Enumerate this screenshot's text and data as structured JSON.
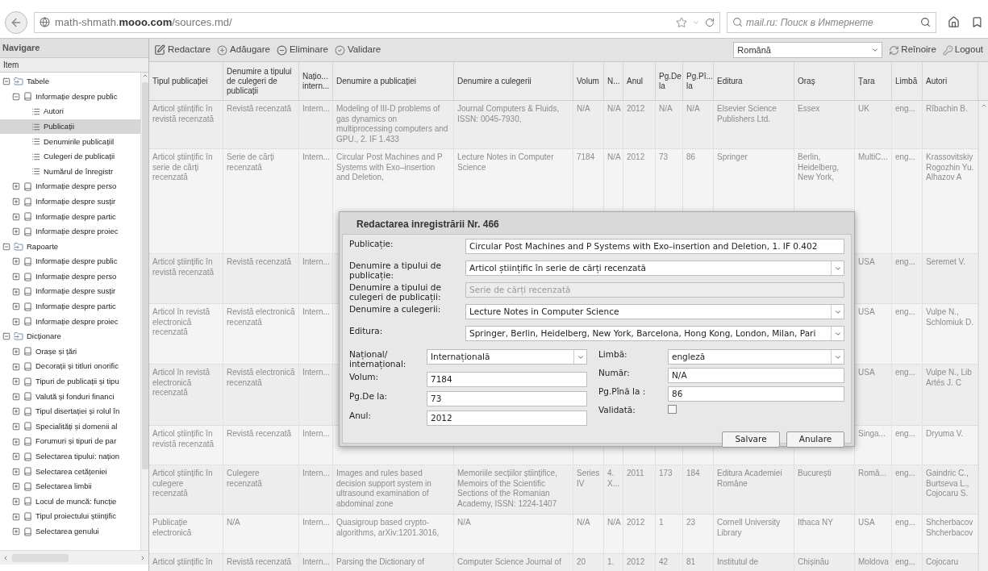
{
  "browser": {
    "url": "math-shmath.**mooo.com**/sources.md/",
    "search_placeholder": "mail.ru: Поиск в Интернете"
  },
  "sidebar": {
    "title": "Navigare",
    "column": "Item",
    "tree": [
      {
        "label": "Tabele",
        "kind": "folder",
        "expanded": true,
        "selected": false,
        "children": [
          {
            "label": "Informație despre public",
            "kind": "book",
            "expanded": true,
            "selected": false,
            "children": [
              {
                "label": "Autori",
                "kind": "table",
                "selected": false
              },
              {
                "label": "Publicații",
                "kind": "table",
                "selected": true
              },
              {
                "label": "Denumirile publicațiil",
                "kind": "table",
                "selected": false
              },
              {
                "label": "Culegeri de publicații",
                "kind": "table",
                "selected": false
              },
              {
                "label": "Numărul de înregistr",
                "kind": "table",
                "selected": false
              }
            ]
          },
          {
            "label": "Informație despre perso",
            "kind": "book",
            "expanded": false,
            "selected": false
          },
          {
            "label": "Informație despre susțir",
            "kind": "book",
            "expanded": false,
            "selected": false
          },
          {
            "label": "Informație despre partic",
            "kind": "book",
            "expanded": false,
            "selected": false
          },
          {
            "label": "Informație despre proiec",
            "kind": "book",
            "expanded": false,
            "selected": false
          }
        ]
      },
      {
        "label": "Rapoarte",
        "kind": "folder",
        "expanded": true,
        "selected": false,
        "children": [
          {
            "label": "Informație despre public",
            "kind": "book",
            "expanded": false,
            "selected": false
          },
          {
            "label": "Informație despre perso",
            "kind": "book",
            "expanded": false,
            "selected": false
          },
          {
            "label": "Informație despre susțir",
            "kind": "book",
            "expanded": false,
            "selected": false
          },
          {
            "label": "Informație despre partic",
            "kind": "book",
            "expanded": false,
            "selected": false
          },
          {
            "label": "Informație despre proiec",
            "kind": "book",
            "expanded": false,
            "selected": false
          }
        ]
      },
      {
        "label": "Dicționare",
        "kind": "folder",
        "expanded": true,
        "selected": false,
        "children": [
          {
            "label": "Orașe și țări",
            "kind": "book",
            "expanded": false,
            "selected": false
          },
          {
            "label": "Decorații și titluri onorific",
            "kind": "book",
            "expanded": false,
            "selected": false
          },
          {
            "label": "Tipuri de publicații și tipu",
            "kind": "book",
            "expanded": false,
            "selected": false
          },
          {
            "label": "Valută și fonduri financi",
            "kind": "book",
            "expanded": false,
            "selected": false
          },
          {
            "label": "Tipul disertației și rolul în",
            "kind": "book",
            "expanded": false,
            "selected": false
          },
          {
            "label": "Specialități și domenii al",
            "kind": "book",
            "expanded": false,
            "selected": false
          },
          {
            "label": "Forumuri și tipuri de par",
            "kind": "book",
            "expanded": false,
            "selected": false
          },
          {
            "label": "Selectarea tipului: națion",
            "kind": "book",
            "expanded": false,
            "selected": false
          },
          {
            "label": "Selectarea cetățeniei",
            "kind": "book",
            "expanded": false,
            "selected": false
          },
          {
            "label": "Selectarea limbii",
            "kind": "book",
            "expanded": false,
            "selected": false
          },
          {
            "label": "Locul de muncă: funcție",
            "kind": "book",
            "expanded": false,
            "selected": false
          },
          {
            "label": "Tipul proiectului științific",
            "kind": "book",
            "expanded": false,
            "selected": false
          },
          {
            "label": "Selectarea genului",
            "kind": "book",
            "expanded": false,
            "selected": false
          }
        ]
      }
    ]
  },
  "toolbar": {
    "buttons": [
      {
        "label": "Redactare",
        "kind": "edit"
      },
      {
        "label": "Adăugare",
        "kind": "add"
      },
      {
        "label": "Eliminare",
        "kind": "remove"
      },
      {
        "label": "Validare",
        "kind": "validate"
      }
    ],
    "language": "Română",
    "right_buttons": [
      {
        "label": "Reînoire",
        "kind": "refresh"
      },
      {
        "label": "Logout",
        "kind": "logout"
      }
    ]
  },
  "table": {
    "columns": [
      "Tipul publicației",
      "Denumire a tipului de culegeri de publicații",
      "Națio... intern...",
      "Denumire a publicației",
      "Denumire a culegerii",
      "Volum",
      "N...",
      "Anul",
      "Pg.De la",
      "Pg.Pî... la",
      "Editura",
      "Oraș",
      "Țara",
      "Limbă",
      "Autori"
    ],
    "rows": [
      [
        "Articol științific în revistă recenzată",
        "Revistă recenzată",
        "Intern...",
        "Modeling of III-D problems of gas dynamics on multiprocessing computers and GPU., 2. IF 1.433",
        "Journal Computers & Fluids, ISSN: 0045-7930,",
        "N/A",
        "N/A",
        "2012",
        "N/A",
        "N/A",
        "Elsevier Science Publishers Ltd.",
        "Essex",
        "UK",
        "eng...",
        "Rîbachin B."
      ],
      [
        "Articol științific în serie de cărți recenzată",
        "Serie de cărți recenzată",
        "Intern...",
        "Circular Post Machines and P Systems with Exo–insertion and Deletion,",
        "Lecture Notes in Computer Science",
        "7184",
        "N/A",
        "2012",
        "73",
        "86",
        "Springer",
        "Berlin, Heidelberg, New York,",
        "MultiC...",
        "eng...",
        "Krassovitskiy Rogozhin Yu. Alhazov A"
      ],
      [
        "Articol științific în revistă recenzată",
        "Revistă recenzată",
        "Intern...",
        null,
        null,
        null,
        null,
        null,
        null,
        null,
        null,
        null,
        "USA",
        "eng...",
        "Seremet V."
      ],
      [
        "Articol în revistă electronică recenzată",
        "Revistă electronică recenzată",
        "Intern...",
        null,
        null,
        null,
        null,
        null,
        null,
        null,
        null,
        null,
        "USA",
        "eng...",
        "Vulpe N., Schlomiuk D."
      ],
      [
        "Articol în revistă electronică recenzată",
        "Revistă electronică recenzată",
        "Intern...",
        null,
        null,
        null,
        null,
        null,
        null,
        null,
        null,
        null,
        "USA",
        "eng...",
        "Vulpe N., Lib Artés J. C"
      ],
      [
        "Articol științific în revistă recenzată",
        "Revistă recenzată",
        "Intern...",
        null,
        null,
        null,
        null,
        null,
        null,
        null,
        null,
        null,
        "Singa...",
        "eng...",
        "Dryuma V."
      ],
      [
        "Articol științific în culegere recenzată",
        "Culegere recenzată",
        "Intern...",
        "Images and rules based decision support system in ultrasound examination of abdominal zone",
        "Memoriile secțiilor științifice, Memoirs of the Scientific Sections of the Romanian Academy, ISSN: 1224-1407",
        "Series IV",
        "4. X...",
        "2011",
        "173",
        "184",
        "Editura Academiei Române",
        "București",
        "Româ...",
        "eng...",
        "Gaindric C., Burtseva L., Cojocaru S."
      ],
      [
        "Publicație electronică",
        "N/A",
        "Intern...",
        "Quasigroup based crypto-algorithms, arXiv:1201.3016,",
        "N/A",
        "N/A",
        "N/A",
        "2012",
        "1",
        "23",
        "Cornell University Library",
        "Ithaca NY",
        "USA",
        "eng...",
        "Shcherbacov Shcherbacov"
      ],
      [
        "Articol științific în",
        "Revistă recenzată",
        "Intern...",
        "Parsing the Dictionary of",
        "Computer Science Journal of",
        "20",
        "1.",
        "2012",
        "42",
        "81",
        "Institutul de",
        "Chișinău",
        "Moldova",
        "eng...",
        "Cojocaru"
      ]
    ]
  },
  "dialog": {
    "title": "Redactarea inregistrării Nr. 466",
    "fields": [
      {
        "label": "Publicație:",
        "kind": "text",
        "value": "Circular Post Machines and P Systems with Exo–insertion and Deletion, 1. IF 0.402",
        "disabled": false
      },
      {
        "label": "Denumire a tipului de publicație:",
        "kind": "select",
        "value": "Articol științific în serie de cărți recenzată",
        "disabled": false
      },
      {
        "label": "Denumire a tipului de culegeri de publicații:",
        "kind": "text",
        "value": "Serie de cărți recenzată",
        "disabled": true
      },
      {
        "label": "Denumire a culegerii:",
        "kind": "select",
        "value": "Lecture Notes in Computer Science",
        "disabled": false
      },
      {
        "label": "Editura:",
        "kind": "select",
        "value": "Springer, Berlin, Heidelberg, New York, Barcelona, Hong Kong, London, Milan, Pari",
        "disabled": false
      }
    ],
    "left_fields": [
      {
        "label": "Național/ internațional:",
        "kind": "select",
        "value": "Internațională"
      },
      {
        "label": "Volum:",
        "kind": "text",
        "value": "7184"
      },
      {
        "label": "Pg.De la:",
        "kind": "text",
        "value": "73"
      },
      {
        "label": "Anul:",
        "kind": "text",
        "value": "2012"
      }
    ],
    "right_fields": [
      {
        "label": "Limbă:",
        "kind": "select",
        "value": "engleză"
      },
      {
        "label": "Număr:",
        "kind": "text",
        "value": "N/A"
      },
      {
        "label": "Pg.Pînă la :",
        "kind": "text",
        "value": "86"
      },
      {
        "label": "Validată:",
        "kind": "checkbox",
        "checked": false
      }
    ],
    "buttons": [
      "Salvare",
      "Anulare"
    ]
  }
}
